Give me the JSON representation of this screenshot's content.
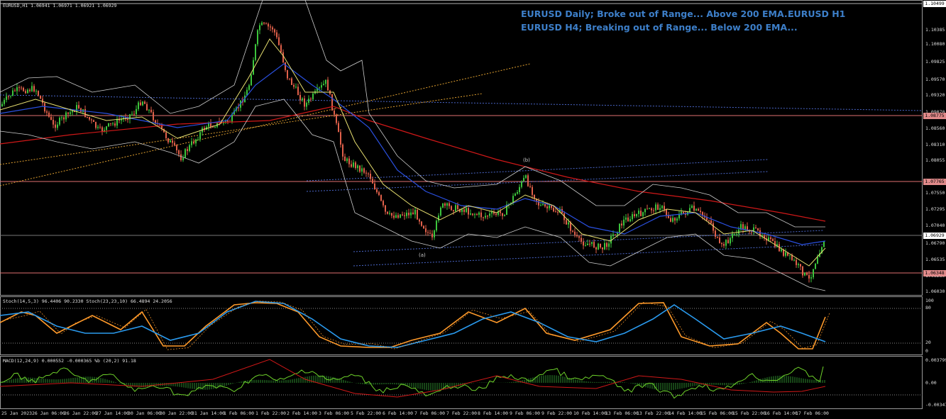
{
  "symbol_header": "EURUSD,H1  1.06941 1.06971 1.06921 1.06929",
  "annotation": {
    "line1": "EURUSD Daily; Broke out of Range... Above 200 EMA...",
    "line1_right": "EURUSD H1",
    "line2": "EURUSD H4; Breaking out of Range... Below 200 EMA..."
  },
  "price_scale": [
    "1.10499",
    "1.10385",
    "1.10080",
    "1.09825",
    "1.09570",
    "1.09320",
    "1.09070",
    "1.08560",
    "1.08310",
    "1.08055",
    "1.07550",
    "1.07295",
    "1.07040",
    "1.06790",
    "1.06535",
    "1.06280",
    "1.06030"
  ],
  "price_tags": {
    "top": "1.10499",
    "upper_red": "1.08775",
    "mid_red": "1.07765",
    "current": "1.06929",
    "lower_red": "1.06348"
  },
  "wave_labels": {
    "a": "(a)",
    "b": "(b)"
  },
  "stoch": {
    "header": "Stoch(14,5,3) 96.4406 90.2330  Stoch(23,23,10) 66.4894 24.2056",
    "scale": [
      "100",
      "80",
      "20",
      "0"
    ]
  },
  "macd": {
    "header": "MACD(12,24,9) 0.000552 -0.000365  %b (20,2) 91.18",
    "scale": [
      "0.003799",
      "0.00",
      "-0.003474"
    ]
  },
  "time_labels": [
    "25 Jan 2023",
    "26 Jan 06:00",
    "26 Jan 22:00",
    "27 Jan 14:00",
    "30 Jan 06:00",
    "30 Jan 22:00",
    "31 Jan 14:00",
    "1 Feb 06:00",
    "1 Feb 22:00",
    "2 Feb 14:00",
    "3 Feb 06:00",
    "5 Feb 22:00",
    "6 Feb 14:00",
    "7 Feb 06:00",
    "7 Feb 22:00",
    "8 Feb 14:00",
    "9 Feb 06:00",
    "9 Feb 22:00",
    "10 Feb 14:00",
    "13 Feb 06:00",
    "13 Feb 22:00",
    "14 Feb 14:00",
    "15 Feb 06:00",
    "15 Feb 22:00",
    "16 Feb 14:00",
    "17 Feb 06:00"
  ],
  "colors": {
    "bull": "#3cc43c",
    "bear": "#e0604a",
    "ema200": "#d01818",
    "ema_blue": "#2a50e0",
    "ema_yellow": "#e8e070",
    "bands": "#cccccc",
    "channel": "#4a66c8",
    "trend": "#e0a030",
    "stoch_fast": "#ff9a2a",
    "stoch_slow": "#2a9aee",
    "macd_line": "#6ed32a",
    "macd_signal": "#d01818"
  }
}
